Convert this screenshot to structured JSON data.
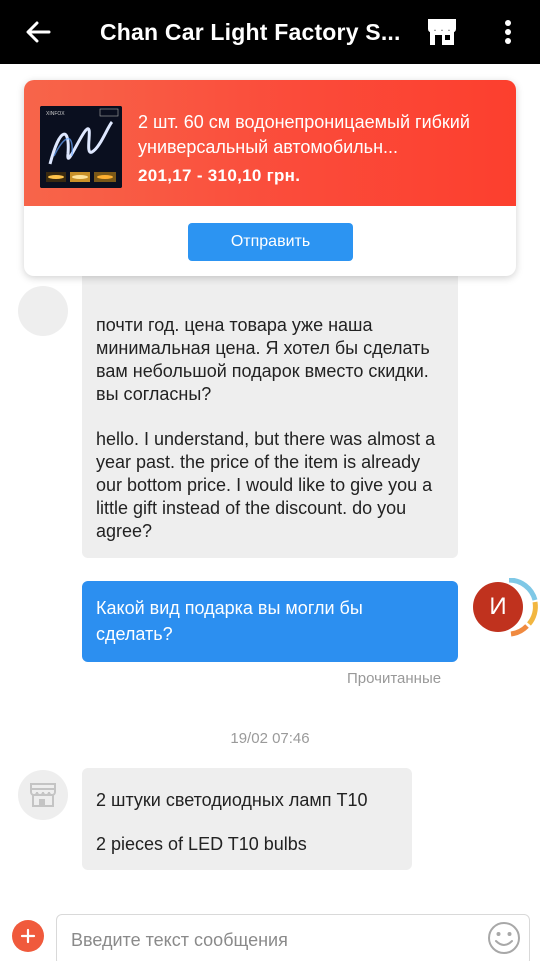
{
  "header": {
    "title": "Chan Car Light Factory S...",
    "icons": [
      "back-arrow-icon",
      "store-icon",
      "more-vertical-icon"
    ]
  },
  "product": {
    "name": "2 шт. 60 см водонепроницаемый гибкий универсальный автомобильн...",
    "price": "201,17 - 310,10 грн.",
    "send_label": "Отправить",
    "thumb_brand": "XINFOX"
  },
  "messages": [
    {
      "direction": "in",
      "paragraphs": [
        "почти год. цена товара уже наша минимальная цена. Я хотел бы сделать вам небольшой подарок вместо скидки. вы согласны?",
        "hello. I understand, but there was almost a year past. the price of the item is already our bottom price. I would like to give you a little gift instead of the discount. do you agree?"
      ]
    },
    {
      "direction": "out",
      "text": "Какой вид подарка вы могли бы сделать?",
      "avatar_letter": "И",
      "status": "Прочитанные"
    },
    {
      "timestamp": "19/02 07:46"
    },
    {
      "direction": "in",
      "paragraphs": [
        "2 штуки светодиодных ламп T10",
        "2 pieces of LED T10 bulbs"
      ]
    }
  ],
  "input": {
    "placeholder": "Введите текст сообщения"
  },
  "colors": {
    "accent_blue": "#2c8ff0",
    "product_gradient_start": "#f7654a",
    "product_gradient_end": "#fc3f2e",
    "plus_button": "#f05a3c",
    "avatar_red": "#c0321e"
  }
}
